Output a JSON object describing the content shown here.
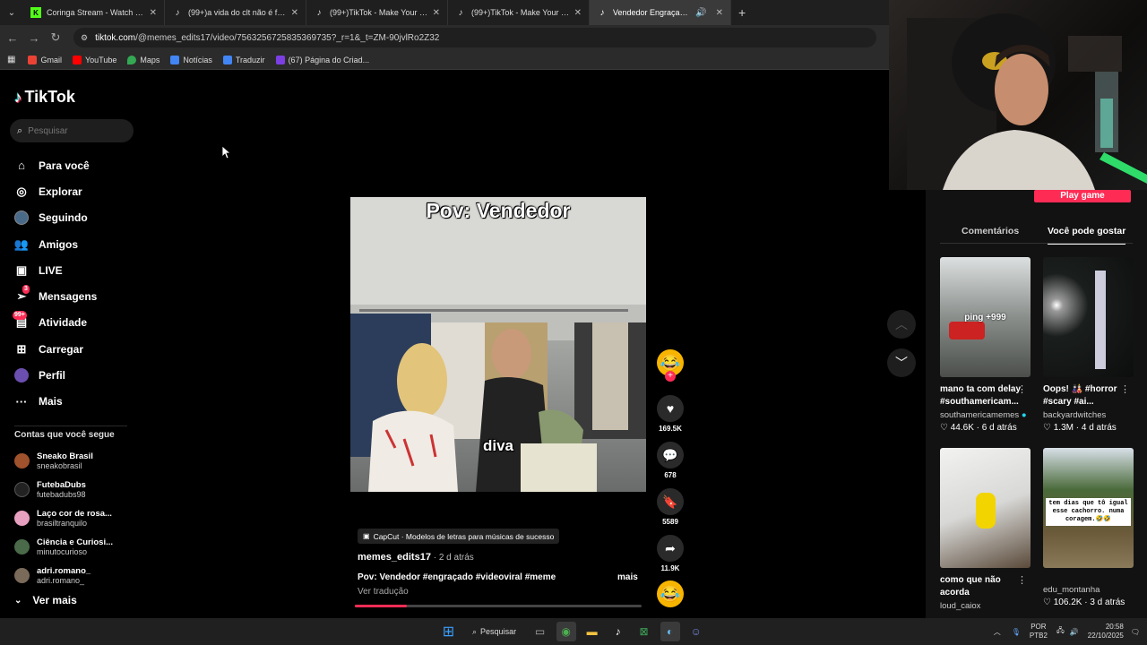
{
  "browser": {
    "tabs": [
      {
        "title": "Coringa Stream - Watch Live on",
        "icon": "kick-icon",
        "color": "#53fc18"
      },
      {
        "title": "(99+)a vida do clt não é fácil ki",
        "icon": "tiktok-icon",
        "color": "#ffffff"
      },
      {
        "title": "(99+)TikTok - Make Your Day",
        "icon": "tiktok-icon",
        "color": "#ffffff"
      },
      {
        "title": "(99+)TikTok - Make Your Day",
        "icon": "tiktok-icon",
        "color": "#ffffff"
      },
      {
        "title": "Vendedor Engraçado: Meme",
        "icon": "tiktok-icon",
        "color": "#ffffff"
      }
    ],
    "url_domain": "tiktok.com",
    "url_path": "/@memes_edits17/video/7563256725835369735?_r=1&_t=ZM-90jvlRo2Z32",
    "bookmarks": [
      {
        "label": "Gmail",
        "color": "#ea4335"
      },
      {
        "label": "YouTube",
        "color": "#ff0000"
      },
      {
        "label": "Maps",
        "color": "#34a853"
      },
      {
        "label": "Notícias",
        "color": "#4285f4"
      },
      {
        "label": "Traduzir",
        "color": "#4285f4"
      },
      {
        "label": "(67) Página do Criad...",
        "color": "#7b3fe4"
      }
    ]
  },
  "sidebar": {
    "logo": "TikTok",
    "search_placeholder": "Pesquisar",
    "nav": [
      {
        "label": "Para você",
        "icon": "home-icon"
      },
      {
        "label": "Explorar",
        "icon": "compass-icon"
      },
      {
        "label": "Seguindo",
        "icon": "following-avatar-icon"
      },
      {
        "label": "Amigos",
        "icon": "friends-icon"
      },
      {
        "label": "LIVE",
        "icon": "live-icon"
      },
      {
        "label": "Mensagens",
        "icon": "messages-icon",
        "badge": "3"
      },
      {
        "label": "Atividade",
        "icon": "activity-icon",
        "badge": "99+"
      },
      {
        "label": "Carregar",
        "icon": "upload-icon"
      },
      {
        "label": "Perfil",
        "icon": "profile-icon"
      },
      {
        "label": "Mais",
        "icon": "more-icon"
      }
    ],
    "following_title": "Contas que você segue",
    "following": [
      {
        "name": "Sneako Brasil",
        "handle": "sneakobrasil",
        "color": "#a0522d"
      },
      {
        "name": "FutebaDubs",
        "handle": "futebadubs98",
        "color": "#222222"
      },
      {
        "name": "Laço cor de rosa...",
        "handle": "brasiltranquilo",
        "color": "#e8a0c0"
      },
      {
        "name": "Ciência e Curiosi...",
        "handle": "minutocurioso",
        "color": "#4a6a4a"
      },
      {
        "name": "adri.romano_",
        "handle": "adri.romano_",
        "color": "#7a6a5a"
      }
    ],
    "see_more": "Ver mais"
  },
  "video": {
    "caption_top": "Pov: Vendedor",
    "caption_bottom": "diva",
    "likes": "169.5K",
    "comments": "678",
    "saves": "5589",
    "shares": "11.9K",
    "capcut": "CapCut · Modelos de letras para músicas de sucesso",
    "author": "memes_edits17",
    "date": " · 2 d atrás",
    "description": "Pov: Vendedor #engraçado #videoviral #meme",
    "more": "mais",
    "translate": "Ver tradução",
    "progress": 0.18
  },
  "right_panel": {
    "play_game": "Play game",
    "tabs": [
      "Comentários",
      "Você pode gostar"
    ],
    "cards": [
      {
        "overlay": "ping +999",
        "title": "mano ta com delay #southamericam...",
        "user": "southamericamemes",
        "likes": "44.6K",
        "date": "6 d atrás"
      },
      {
        "overlay": "",
        "title": "Oops! 🎎 #horror #scary #ai...",
        "user": "backyardwitches",
        "likes": "1.3M",
        "date": "4 d atrás"
      },
      {
        "overlay": "",
        "title": "como que não acorda",
        "user": "loud_caiox",
        "likes": "",
        "date": ""
      },
      {
        "overlay": "tem dias que tô igual esse cachorro. numa coragem.🤣🤣",
        "title": "",
        "user": "edu_montanha",
        "likes": "106.2K",
        "date": "3 d atrás"
      }
    ]
  },
  "taskbar": {
    "search": "Pesquisar",
    "lang1": "POR",
    "lang2": "PTB2",
    "time": "20:58",
    "date": "22/10/2025"
  }
}
